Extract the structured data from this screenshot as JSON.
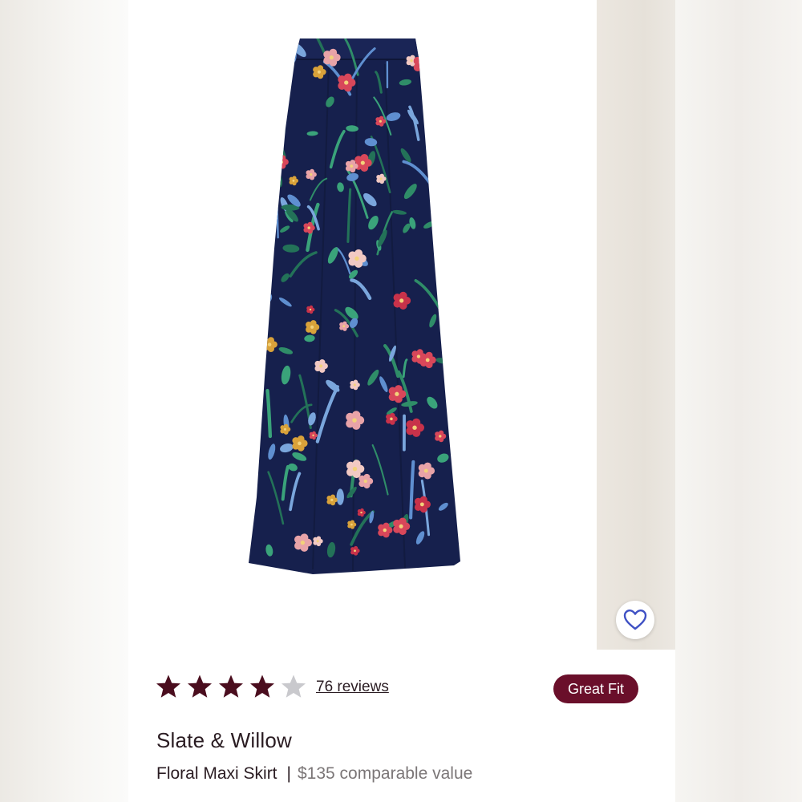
{
  "product": {
    "image_alt": "Floral Maxi Skirt",
    "rating": 4,
    "rating_max": 5,
    "reviews_label": "76 reviews",
    "fit_badge": "Great Fit",
    "brand": "Slate & Willow",
    "name": "Floral Maxi Skirt",
    "separator": "|",
    "price_label": "$135 comparable value"
  },
  "icons": {
    "favorite": "heart-outline-icon",
    "star": "star-icon"
  },
  "colors": {
    "star_filled": "#4a0d1e",
    "star_empty": "#c9c9cd",
    "badge": "#6a0f2a",
    "heart": "#3f51c4",
    "skirt": "#16204d"
  }
}
